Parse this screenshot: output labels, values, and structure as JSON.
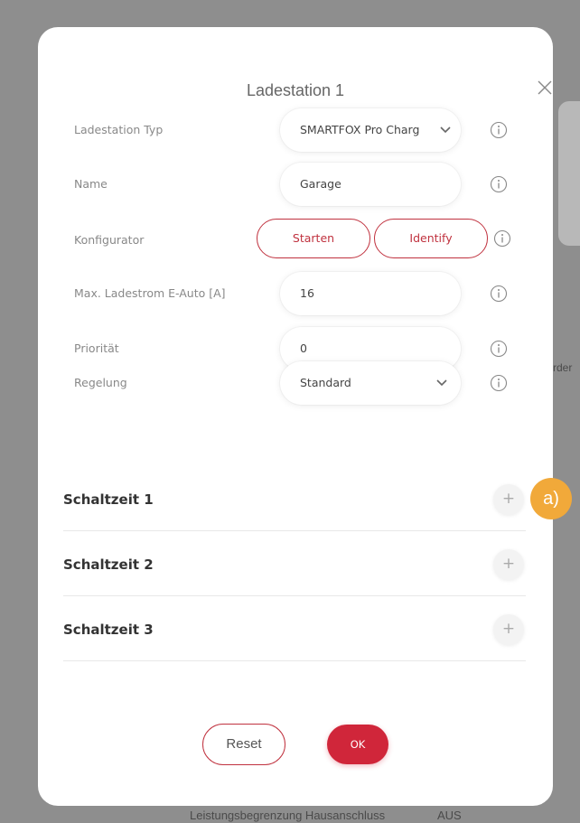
{
  "background": {
    "side_text": "rder",
    "footer_label": "Leistungsbegrenzung Hausanschluss",
    "footer_value": "AUS"
  },
  "dialog": {
    "title": "Ladestation 1",
    "close_icon": "close-icon",
    "fields": [
      {
        "label": "Ladestation Typ",
        "value": "SMARTFOX Pro Charg",
        "kind": "select"
      },
      {
        "label": "Name",
        "value": "Garage",
        "kind": "input"
      },
      {
        "label": "Konfigurator",
        "kind": "buttons"
      },
      {
        "label": "Max. Ladestrom E-Auto [A]",
        "value": "16",
        "kind": "input"
      },
      {
        "label": "Priorität",
        "value": "0",
        "kind": "input"
      },
      {
        "label": "Regelung",
        "value": "Standard",
        "kind": "select"
      }
    ],
    "configurator": {
      "start_label": "Starten",
      "identify_label": "Identify"
    },
    "schedules": [
      {
        "label": "Schaltzeit 1"
      },
      {
        "label": "Schaltzeit 2"
      },
      {
        "label": "Schaltzeit 3"
      }
    ],
    "add_symbol": "+",
    "reset_label": "Reset",
    "ok_label": "OK"
  },
  "annotation": {
    "badge_label": "a)"
  },
  "colors": {
    "accent": "#c0323f",
    "ok_fill": "#d0263a",
    "badge": "#f1a93a",
    "overlay": "#8e8e8e"
  }
}
